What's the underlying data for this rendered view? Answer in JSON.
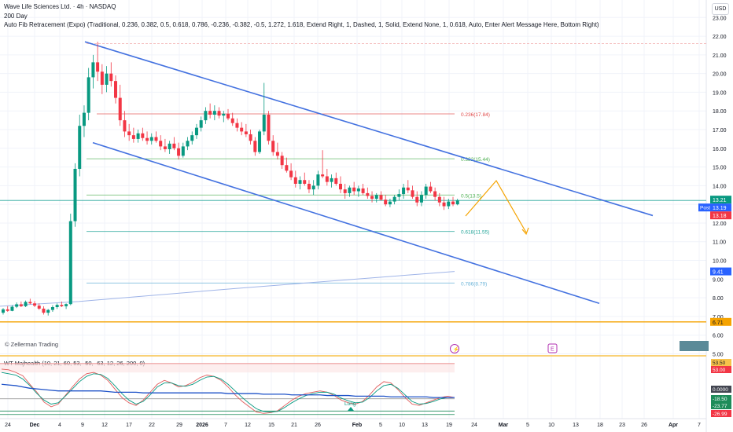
{
  "header": {
    "title": "Wave Life Sciences Ltd. · 4h · NASDAQ",
    "indicator_1": "200 Day",
    "indicator_2": "Auto Fib Retracement (Expo) (Traditional, 0.236, 0.382, 0.5, 0.618, 0.786, -0.236, -0.382, -0.5, 1.272, 1.618, Extend Right, 1, Dashed, 1, Solid, Extend None, 1, 0.618, Auto, Enter Alert Message Here, Bottom Right)"
  },
  "currency_button": "USD",
  "watermark": "© Zellerman Trading",
  "event_icons": [
    "dividend-icon",
    "earnings-icon"
  ],
  "colors": {
    "up": "#089981",
    "down": "#f23645",
    "channel": "#4472e0",
    "orange": "#f5a300",
    "fib_red": "#e04848",
    "fib_green": "#4caf50",
    "fib_teal": "#26a69a",
    "ma_line": "#9fb4e8",
    "wt_blue": "#1e52c8"
  },
  "chart_data": [
    {
      "type": "candlestick",
      "title": "Wave Life Sciences Ltd. · 4h · NASDAQ",
      "y_axis": {
        "ylim": [
          4.6,
          23.6
        ],
        "ticks": [
          23,
          22,
          21,
          20,
          19,
          18,
          17,
          16,
          15,
          14,
          13,
          12,
          11,
          10,
          9,
          8,
          7,
          6,
          5
        ]
      },
      "x_axis": {
        "ticks": [
          "24",
          "Dec",
          "4",
          "9",
          "12",
          "17",
          "22",
          "29",
          "2026",
          "7",
          "12",
          "15",
          "21",
          "26",
          "Feb",
          "5",
          "10",
          "13",
          "19",
          "24",
          "Mar",
          "5",
          "10",
          "13",
          "18",
          "23",
          "26",
          "Apr",
          "7"
        ]
      },
      "bars_per_day": 2,
      "candles": [
        [
          7.2,
          7.45,
          7.1,
          7.38
        ],
        [
          7.38,
          7.55,
          7.25,
          7.3
        ],
        [
          7.3,
          7.6,
          7.28,
          7.52
        ],
        [
          7.52,
          7.75,
          7.45,
          7.65
        ],
        [
          7.65,
          7.8,
          7.5,
          7.55
        ],
        [
          7.55,
          7.85,
          7.5,
          7.78
        ],
        [
          7.78,
          7.95,
          7.65,
          7.7
        ],
        [
          7.7,
          7.82,
          7.5,
          7.58
        ],
        [
          7.58,
          7.7,
          7.35,
          7.42
        ],
        [
          7.42,
          7.55,
          7.1,
          7.2
        ],
        [
          7.2,
          7.4,
          7.05,
          7.35
        ],
        [
          7.35,
          7.6,
          7.25,
          7.5
        ],
        [
          7.5,
          7.7,
          7.4,
          7.62
        ],
        [
          7.62,
          7.8,
          7.5,
          7.55
        ],
        [
          7.55,
          7.7,
          7.4,
          7.66
        ],
        [
          7.66,
          12.5,
          7.6,
          12.1
        ],
        [
          12.1,
          15.2,
          11.8,
          14.9
        ],
        [
          14.9,
          17.8,
          14.5,
          17.2
        ],
        [
          17.2,
          18.3,
          16.6,
          17.9
        ],
        [
          17.9,
          20.3,
          17.5,
          19.8
        ],
        [
          19.8,
          21.0,
          19.2,
          20.6
        ],
        [
          20.6,
          21.7,
          19.6,
          20.1
        ],
        [
          20.1,
          20.5,
          18.9,
          19.4
        ],
        [
          19.4,
          20.4,
          19.0,
          20.0
        ],
        [
          20.0,
          20.6,
          19.3,
          19.6
        ],
        [
          19.6,
          19.9,
          18.4,
          18.7
        ],
        [
          18.7,
          19.4,
          17.2,
          17.5
        ],
        [
          17.5,
          18.0,
          16.6,
          16.9
        ],
        [
          16.9,
          17.3,
          16.4,
          16.7
        ],
        [
          16.7,
          17.1,
          16.3,
          16.5
        ],
        [
          16.5,
          17.0,
          16.3,
          16.8
        ],
        [
          16.8,
          17.1,
          16.4,
          16.55
        ],
        [
          16.55,
          16.9,
          16.2,
          16.4
        ],
        [
          16.4,
          16.8,
          16.2,
          16.6
        ],
        [
          16.6,
          16.9,
          16.3,
          16.4
        ],
        [
          16.4,
          16.7,
          15.9,
          16.1
        ],
        [
          16.1,
          16.5,
          15.8,
          15.95
        ],
        [
          15.95,
          16.4,
          15.7,
          16.25
        ],
        [
          16.25,
          16.6,
          15.9,
          16.0
        ],
        [
          16.0,
          16.3,
          15.4,
          15.6
        ],
        [
          15.6,
          16.3,
          15.5,
          16.1
        ],
        [
          16.1,
          16.6,
          15.9,
          16.4
        ],
        [
          16.4,
          16.9,
          16.2,
          16.7
        ],
        [
          16.7,
          17.3,
          16.5,
          17.1
        ],
        [
          17.1,
          17.7,
          16.9,
          17.5
        ],
        [
          17.5,
          18.2,
          17.3,
          18.0
        ],
        [
          18.0,
          18.4,
          17.6,
          17.8
        ],
        [
          17.8,
          18.3,
          17.5,
          18.0
        ],
        [
          18.0,
          18.2,
          17.6,
          17.75
        ],
        [
          17.75,
          18.0,
          17.4,
          17.85
        ],
        [
          17.85,
          18.1,
          17.5,
          17.6
        ],
        [
          17.6,
          17.9,
          17.2,
          17.35
        ],
        [
          17.35,
          17.6,
          16.9,
          17.1
        ],
        [
          17.1,
          17.4,
          16.7,
          16.9
        ],
        [
          16.9,
          17.3,
          16.6,
          16.75
        ],
        [
          16.75,
          17.0,
          16.2,
          16.4
        ],
        [
          16.4,
          16.6,
          15.6,
          15.8
        ],
        [
          15.8,
          17.0,
          15.7,
          16.9
        ],
        [
          16.9,
          19.5,
          16.7,
          17.8
        ],
        [
          17.8,
          18.0,
          16.2,
          16.4
        ],
        [
          16.4,
          16.7,
          15.6,
          15.8
        ],
        [
          15.8,
          16.3,
          15.4,
          15.6
        ],
        [
          15.6,
          15.8,
          14.9,
          15.1
        ],
        [
          15.1,
          15.5,
          14.7,
          14.8
        ],
        [
          14.8,
          15.2,
          14.3,
          14.45
        ],
        [
          14.45,
          14.8,
          13.9,
          14.1
        ],
        [
          14.1,
          14.5,
          13.8,
          14.3
        ],
        [
          14.3,
          14.7,
          14.0,
          14.1
        ],
        [
          14.1,
          14.3,
          13.6,
          13.8
        ],
        [
          13.8,
          14.3,
          13.5,
          14.0
        ],
        [
          14.0,
          14.8,
          13.8,
          14.6
        ],
        [
          14.6,
          15.9,
          14.4,
          14.5
        ],
        [
          14.5,
          14.9,
          14.0,
          14.2
        ],
        [
          14.2,
          14.6,
          13.9,
          14.4
        ],
        [
          14.4,
          14.7,
          14.0,
          14.1
        ],
        [
          14.1,
          14.5,
          13.6,
          13.8
        ],
        [
          13.8,
          14.1,
          13.3,
          13.6
        ],
        [
          13.6,
          14.0,
          13.4,
          13.9
        ],
        [
          13.9,
          14.2,
          13.5,
          13.7
        ],
        [
          13.7,
          14.0,
          13.4,
          13.85
        ],
        [
          13.85,
          14.1,
          13.5,
          13.6
        ],
        [
          13.6,
          13.9,
          13.3,
          13.45
        ],
        [
          13.45,
          13.7,
          13.1,
          13.3
        ],
        [
          13.3,
          13.6,
          13.1,
          13.5
        ],
        [
          13.5,
          13.7,
          13.2,
          13.25
        ],
        [
          13.25,
          13.5,
          12.9,
          13.0
        ],
        [
          13.0,
          13.3,
          12.85,
          13.15
        ],
        [
          13.15,
          13.5,
          13.0,
          13.4
        ],
        [
          13.4,
          13.8,
          13.2,
          13.55
        ],
        [
          13.55,
          14.1,
          13.3,
          13.9
        ],
        [
          13.9,
          14.3,
          13.6,
          13.75
        ],
        [
          13.75,
          14.0,
          13.3,
          13.4
        ],
        [
          13.4,
          13.7,
          12.9,
          13.1
        ],
        [
          13.1,
          13.7,
          12.9,
          13.5
        ],
        [
          13.5,
          14.1,
          13.3,
          13.95
        ],
        [
          13.95,
          14.2,
          13.6,
          13.7
        ],
        [
          13.7,
          13.9,
          13.2,
          13.4
        ],
        [
          13.4,
          13.6,
          12.9,
          13.1
        ],
        [
          13.1,
          13.4,
          12.7,
          12.9
        ],
        [
          12.9,
          13.3,
          12.75,
          13.15
        ],
        [
          13.15,
          13.4,
          12.9,
          13.0
        ],
        [
          13.0,
          13.3,
          12.95,
          13.21
        ]
      ]
    },
    {
      "type": "line",
      "title": "WT Majhealth (10, 21, 60, 53, -50, -63, 12, 26, 200, 0)",
      "y_axis": {
        "ylim": [
          -30,
          58
        ]
      },
      "series": [
        {
          "y": [
            45,
            44,
            40,
            35,
            22,
            10,
            -5,
            -12,
            -8,
            5,
            18,
            30,
            38,
            40,
            36,
            28,
            15,
            2,
            -6,
            -10,
            -2,
            10,
            22,
            28,
            24,
            18,
            20,
            25,
            32,
            36,
            34,
            28,
            18,
            6,
            -4,
            -12,
            -20,
            -22,
            -21,
            -18,
            -10,
            -2,
            4,
            8,
            10,
            12,
            10,
            5,
            -2,
            -6,
            -8,
            -4,
            6,
            18,
            26,
            24,
            14,
            2,
            -8,
            -10,
            -6,
            -2,
            2,
            4,
            2
          ]
        },
        {
          "y": [
            40,
            38,
            36,
            30,
            20,
            8,
            -2,
            -8,
            -6,
            4,
            15,
            26,
            34,
            38,
            37,
            31,
            20,
            8,
            -2,
            -8,
            -4,
            6,
            18,
            24,
            24,
            20,
            19,
            22,
            28,
            33,
            34,
            30,
            22,
            12,
            2,
            -7,
            -15,
            -19,
            -20,
            -19,
            -13,
            -6,
            0,
            5,
            8,
            10,
            10,
            7,
            1,
            -3,
            -6,
            -5,
            2,
            12,
            20,
            22,
            16,
            6,
            -4,
            -8,
            -7,
            -4,
            0,
            2,
            2
          ]
        },
        {
          "y": [
            22,
            21,
            20,
            18,
            16,
            15,
            14,
            13,
            12,
            12,
            12,
            12,
            12,
            12,
            12,
            11,
            10,
            10,
            10,
            10,
            9,
            9,
            9,
            9,
            9,
            9,
            9,
            9,
            9,
            9,
            9,
            9,
            8,
            8,
            8,
            8,
            8,
            7,
            7,
            7,
            7,
            6,
            6,
            6,
            6,
            6,
            5,
            5,
            5,
            5,
            4,
            4,
            4,
            4,
            4,
            3,
            3,
            3,
            3,
            3,
            3,
            2,
            2,
            2,
            2
          ]
        }
      ],
      "labels": {
        "axis_values": [
          "53.50",
          "53.00",
          "0.0000",
          "-18.50",
          "-23.77",
          "-26.99"
        ],
        "signal": "Long"
      }
    }
  ],
  "fib_levels": [
    {
      "label": "0.236(17.84)",
      "value": 17.84
    },
    {
      "label": "0.382(15.44)",
      "value": 15.44
    },
    {
      "label": "0.5(13.5)",
      "value": 13.5
    },
    {
      "label": "0.618(11.55)",
      "value": 11.55
    },
    {
      "label": "0.786(8.79)",
      "value": 8.79
    }
  ],
  "price_tags": {
    "current": "13.21",
    "post_label": "Post",
    "post_price": "13.19",
    "red_price": "13.18",
    "channel_price": "12.83",
    "ma_price": "9.41",
    "support_price": "6.71",
    "current_value": 13.21,
    "ma_value": 9.41,
    "support_value": 6.71
  }
}
